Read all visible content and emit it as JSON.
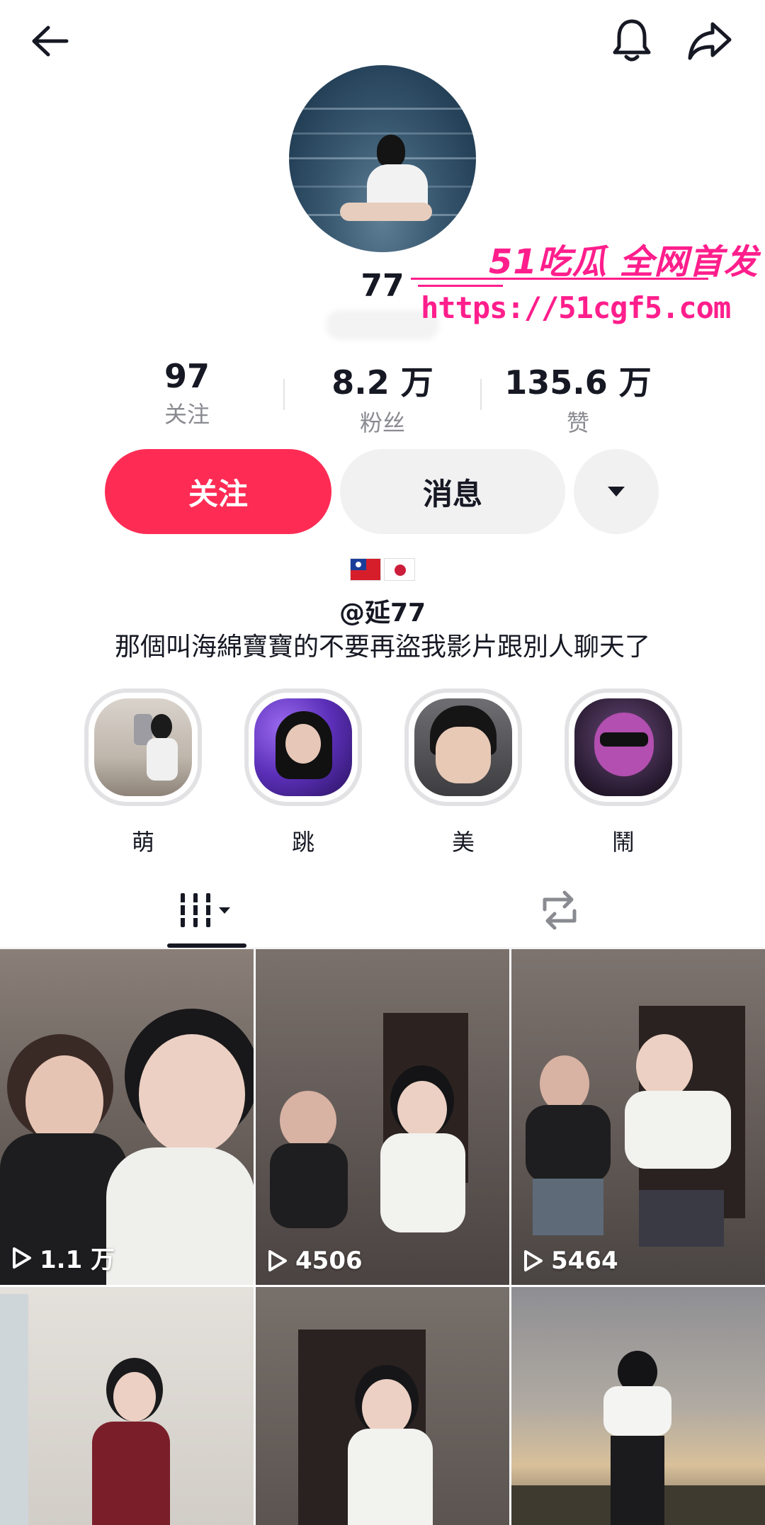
{
  "profile": {
    "name": "77",
    "handle": "@延77",
    "bio": "那個叫海綿寶寶的不要再盜我影片跟別人聊天了"
  },
  "watermark": {
    "line1": "51吃瓜 全网首发",
    "line2": "https://51cgf5.com"
  },
  "stats": [
    {
      "value": "97",
      "label": "关注"
    },
    {
      "value": "8.2 万",
      "label": "粉丝"
    },
    {
      "value": "135.6 万",
      "label": "赞"
    }
  ],
  "actions": {
    "follow": "关注",
    "message": "消息"
  },
  "highlights": [
    {
      "label": "萌"
    },
    {
      "label": "跳"
    },
    {
      "label": "美"
    },
    {
      "label": "鬧"
    }
  ],
  "videos": [
    {
      "views": "1.1 万"
    },
    {
      "views": "4506"
    },
    {
      "views": "5464"
    },
    {
      "views": ""
    },
    {
      "views": ""
    },
    {
      "views": ""
    }
  ],
  "icons": {
    "back": "back-arrow-icon",
    "bell": "bell-icon",
    "share": "share-icon",
    "dropdown": "triangle-down-icon",
    "videos_tab": "grid-icon",
    "reposts_tab": "repost-icon",
    "play": "play-icon"
  },
  "colors": {
    "accent": "#fe2c55",
    "button_gray": "#f1f1f2",
    "watermark": "#ff1e8c",
    "secondary_text": "#8a8b91"
  }
}
